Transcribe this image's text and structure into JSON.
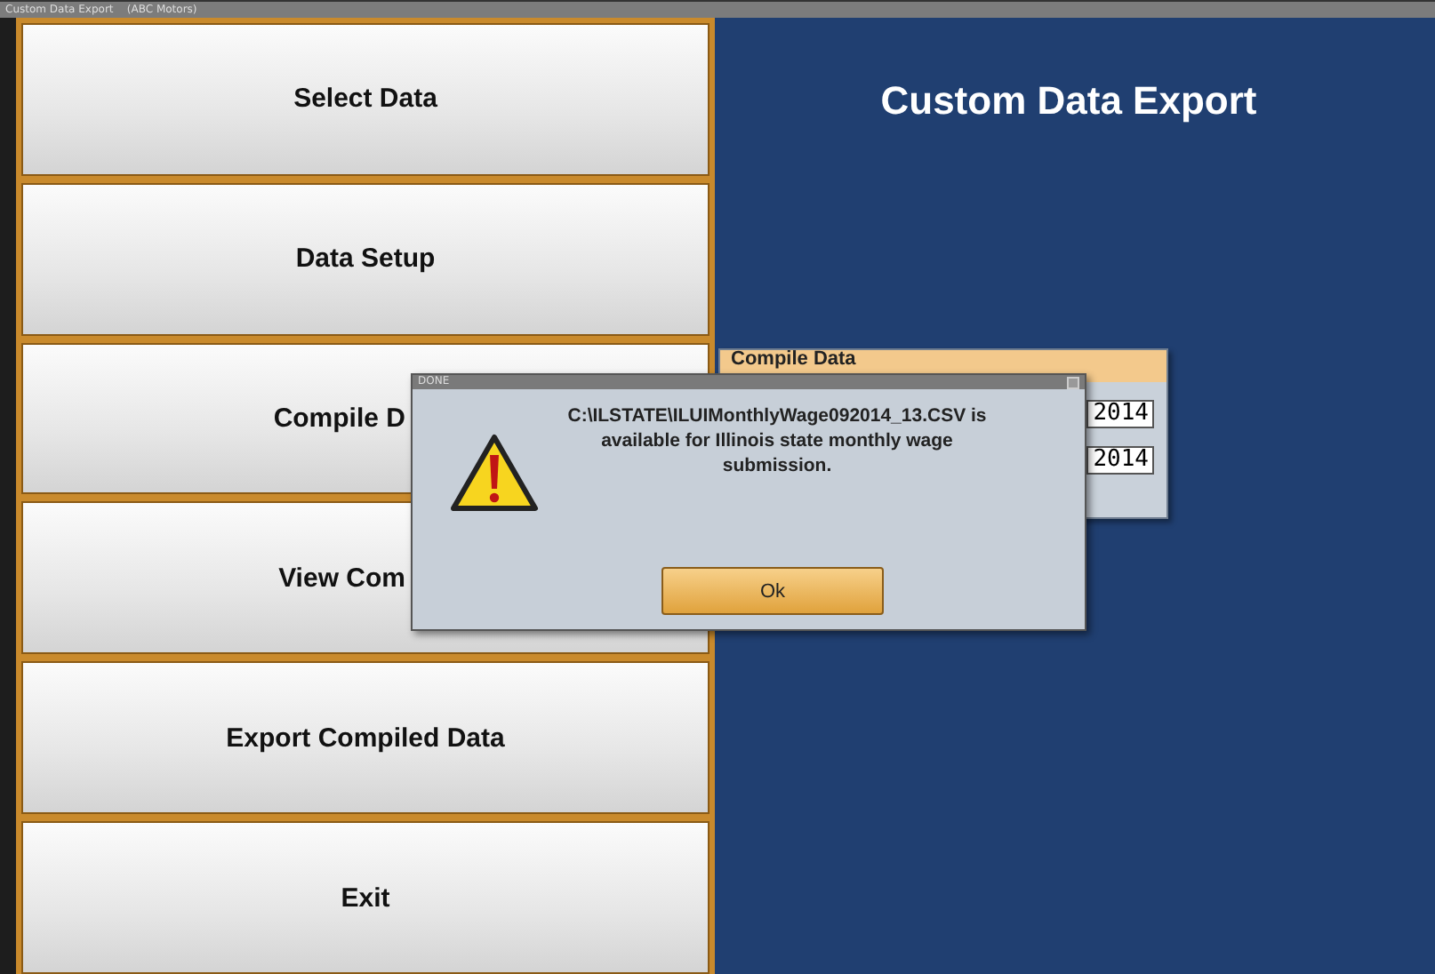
{
  "window": {
    "title": "Custom Data Export    (ABC Motors)"
  },
  "menu_buttons": [
    {
      "label": "Select Data",
      "covered": false
    },
    {
      "label": "Data Setup",
      "covered": false
    },
    {
      "label": "Compile D",
      "covered": true
    },
    {
      "label": "View Com",
      "covered": true
    },
    {
      "label": "Export Compiled Data",
      "covered": false
    },
    {
      "label": "Exit",
      "covered": false
    }
  ],
  "heading": "Custom Data Export",
  "compile_panel": {
    "title": "Compile Data",
    "fields": [
      {
        "value": "2014"
      },
      {
        "value": "2014"
      }
    ]
  },
  "dialog": {
    "title": "DONE",
    "message": "C:\\ILSTATE\\ILUIMonthlyWage092014_13.CSV is available for Illinois state monthly wage submission.",
    "button": "Ok"
  }
}
